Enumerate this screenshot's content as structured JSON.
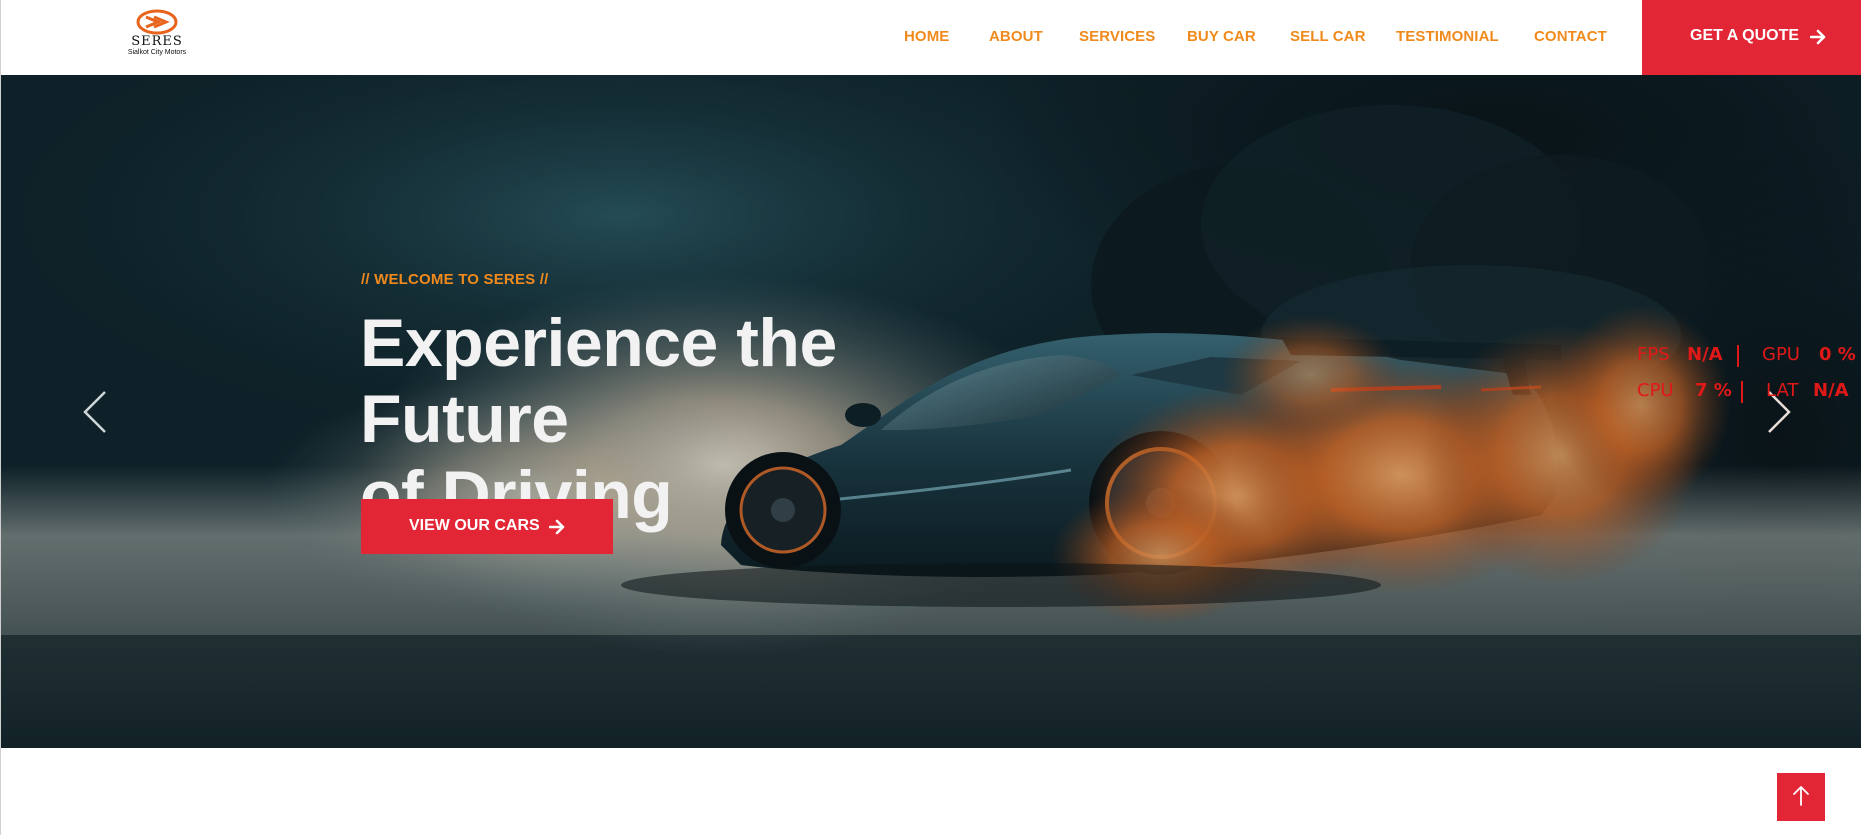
{
  "brand": {
    "name": "SERES",
    "tagline": "Sialkot City Motors",
    "logo_icon": "double-chevron-oval-logo",
    "colors": {
      "accent_orange": "#f08a1c",
      "accent_red": "#e32636"
    }
  },
  "nav": {
    "items": [
      {
        "label": "HOME"
      },
      {
        "label": "ABOUT"
      },
      {
        "label": "SERVICES"
      },
      {
        "label": "BUY CAR"
      },
      {
        "label": "SELL CAR"
      },
      {
        "label": "TESTIMONIAL"
      },
      {
        "label": "CONTACT"
      }
    ],
    "quote_button": {
      "label": "GET A QUOTE",
      "icon": "arrow-right-icon"
    }
  },
  "hero": {
    "tagline": "// WELCOME TO SERES //",
    "title_line1": "Experience the Future",
    "title_line2": "of Driving",
    "cta": {
      "label": "VIEW OUR CARS",
      "icon": "arrow-right-icon"
    },
    "prev_icon": "chevron-left-icon",
    "next_icon": "chevron-right-icon",
    "image_subject": "sports car drifting with orange tire smoke"
  },
  "perf_overlay": {
    "fps_label": "FPS",
    "fps_value": "N/A",
    "gpu_label": "GPU",
    "gpu_value": "0 %",
    "cpu_label": "CPU",
    "cpu_value": "7 %",
    "lat_label": "LAT",
    "lat_value": "N/A"
  },
  "back_to_top": {
    "icon": "arrow-up-icon"
  }
}
